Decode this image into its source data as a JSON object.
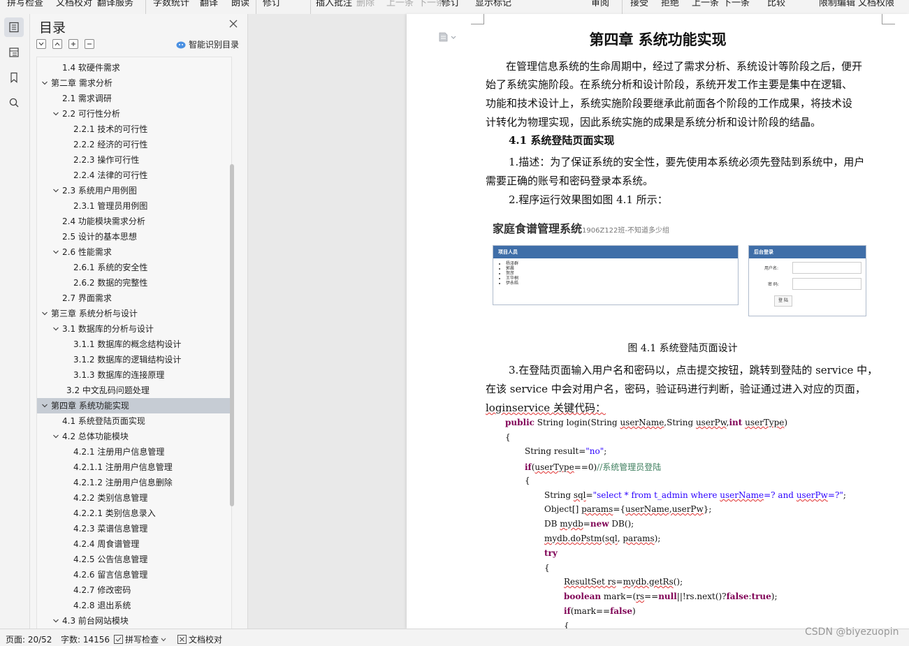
{
  "toolbar": {
    "items": [
      "拼写检查",
      "文档校对",
      "翻译服务",
      "字数统计",
      "翻译",
      "朗读",
      "修订",
      "插入批注",
      "删除",
      "上一条",
      "下一条",
      "修订",
      "显示标记",
      "审阅",
      "接受",
      "拒绝",
      "上一条",
      "下一条",
      "比较",
      "限制编辑",
      "文档权限"
    ]
  },
  "rail": {
    "icons": [
      "toc-icon",
      "navigation-icon",
      "bookmark-icon",
      "search-icon"
    ]
  },
  "toc": {
    "title": "目录",
    "smart_label": "智能识别目录",
    "items": [
      {
        "text": "1.4 软硬件需求",
        "level": 2,
        "toggle": "none"
      },
      {
        "text": "第二章  需求分析",
        "level": 1,
        "toggle": "expanded"
      },
      {
        "text": "2.1 需求调研",
        "level": 2,
        "toggle": "none"
      },
      {
        "text": "2.2 可行性分析",
        "level": 2,
        "toggle": "expanded"
      },
      {
        "text": "2.2.1 技术的可行性",
        "level": 3,
        "toggle": "none"
      },
      {
        "text": "2.2.2 经济的可行性",
        "level": 3,
        "toggle": "none"
      },
      {
        "text": "2.2.3 操作可行性",
        "level": 3,
        "toggle": "none"
      },
      {
        "text": "2.2.4 法律的可行性",
        "level": 3,
        "toggle": "none"
      },
      {
        "text": "2.3 系统用户用例图",
        "level": 2,
        "toggle": "expanded"
      },
      {
        "text": "2.3.1 管理员用例图",
        "level": 3,
        "toggle": "none"
      },
      {
        "text": "2.4 功能模块需求分析",
        "level": 2,
        "toggle": "none"
      },
      {
        "text": "2.5 设计的基本思想",
        "level": 2,
        "toggle": "none"
      },
      {
        "text": "2.6 性能需求",
        "level": 2,
        "toggle": "expanded"
      },
      {
        "text": "2.6.1 系统的安全性",
        "level": 3,
        "toggle": "none"
      },
      {
        "text": "2.6.2 数据的完整性",
        "level": 3,
        "toggle": "none"
      },
      {
        "text": "2.7 界面需求",
        "level": 2,
        "toggle": "none"
      },
      {
        "text": "第三章  系统分析与设计",
        "level": 1,
        "toggle": "expanded"
      },
      {
        "text": "3.1 数据库的分析与设计",
        "level": 2,
        "toggle": "expanded"
      },
      {
        "text": "3.1.1 数据库的概念结构设计",
        "level": 3,
        "toggle": "none"
      },
      {
        "text": "3.1.2 数据库的逻辑结构设计",
        "level": 3,
        "toggle": "none"
      },
      {
        "text": "3.1.3 数据库的连接原理",
        "level": 3,
        "toggle": "none"
      },
      {
        "text": "3.2 中文乱码问题处理",
        "level": 2.4,
        "toggle": "none"
      },
      {
        "text": "第四章  系统功能实现",
        "level": 1,
        "toggle": "expanded",
        "active": true
      },
      {
        "text": "4.1 系统登陆页面实现",
        "level": 2,
        "toggle": "none"
      },
      {
        "text": "4.2 总体功能模块",
        "level": 2,
        "toggle": "expanded"
      },
      {
        "text": "4.2.1 注册用户信息管理",
        "level": 3,
        "toggle": "none"
      },
      {
        "text": "4.2.1.1 注册用户信息管理",
        "level": 3,
        "toggle": "none"
      },
      {
        "text": "4.2.1.2 注册用户信息删除",
        "level": 3,
        "toggle": "none"
      },
      {
        "text": "4.2.2 类别信息管理",
        "level": 3,
        "toggle": "none"
      },
      {
        "text": "4.2.2.1 类别信息录入",
        "level": 3,
        "toggle": "none"
      },
      {
        "text": "4.2.3 菜谱信息管理",
        "level": 3,
        "toggle": "none"
      },
      {
        "text": "4.2.4 周食谱管理",
        "level": 3,
        "toggle": "none"
      },
      {
        "text": "4.2.5 公告信息管理",
        "level": 3,
        "toggle": "none"
      },
      {
        "text": "4.2.6 留言信息管理",
        "level": 3,
        "toggle": "none"
      },
      {
        "text": "4.2.7 修改密码",
        "level": 3,
        "toggle": "none"
      },
      {
        "text": "4.2.8 退出系统",
        "level": 3,
        "toggle": "none"
      },
      {
        "text": "4.3 前台网站模块",
        "level": 2,
        "toggle": "expanded"
      }
    ]
  },
  "doc": {
    "chapter_title": "第四章  系统功能实现",
    "p1": [
      "在管理信息系统的生命周期中，经过了需求分析、系统设计等阶段之后，便开",
      "始了系统实施阶段。在系统分析和设计阶段，系统开发工作主要是集中在逻辑、",
      "功能和技术设计上，系统实施阶段要继承此前面各个阶段的工作成果，将技术设",
      "计转化为物理实现，因此系统实施的成果是系统分析和设计阶段的结晶。"
    ],
    "section_title": "4.1 系统登陆页面实现",
    "desc": [
      "1.描述：为了保证系统的安全性，要先使用本系统必须先登陆到系统中，用户",
      "需要正确的账号和密码登录本系统。"
    ],
    "p_fig_ref": "2.程序运行效果图如图 4.1 所示：",
    "figure": {
      "app_title": "家庭食谱管理系统",
      "app_subtitle": "1906Z122班-不知道多少组",
      "members_header": "项目人员",
      "members": [
        "杨泽群",
        "郭晨",
        "贺彦",
        "王华桐",
        "伊永皓"
      ],
      "login_header": "后台登录",
      "username_label": "用户名:",
      "password_label": "密  码:",
      "login_button": "登 陆"
    },
    "caption": "图 4.1  系统登陆页面设计",
    "p3": [
      "3.在登陆页面输入用户名和密码以，点击提交按钮，跳转到登陆的 service 中，",
      "在该 service 中会对用户名，密码，验证码进行判断，验证通过进入对应的页面，",
      "loginservice 关键代码："
    ]
  },
  "status": {
    "page": "页面: 20/52",
    "words": "字数: 14156",
    "spell": "拼写检查",
    "proof": "文档校对"
  },
  "watermark": "CSDN @biyezuopin"
}
